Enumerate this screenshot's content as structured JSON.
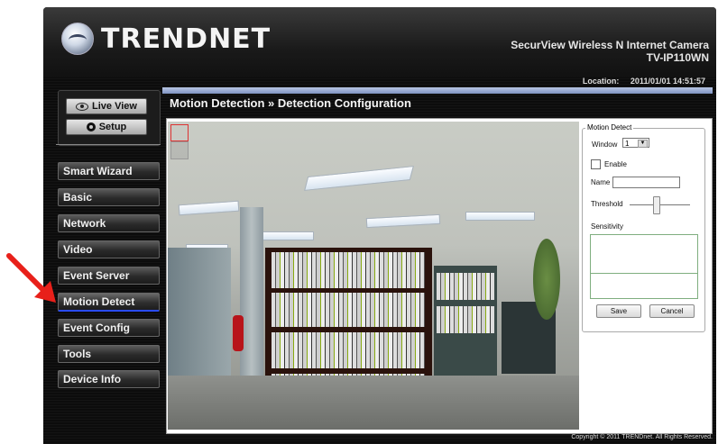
{
  "brand": {
    "logo_text": "TRENDNET"
  },
  "header": {
    "product_line1": "SecurView Wireless N Internet Camera",
    "product_line2": "TV-IP110WN",
    "location_label": "Location:",
    "timestamp": "2011/01/01 14:51:57"
  },
  "top_buttons": {
    "live_view": "Live View",
    "setup": "Setup"
  },
  "nav": {
    "items": [
      "Smart Wizard",
      "Basic",
      "Network",
      "Video",
      "Event Server",
      "Motion Detect",
      "Event Config",
      "Tools",
      "Device Info"
    ],
    "active": "Motion Detect"
  },
  "page": {
    "title": "Motion Detection » Detection Configuration"
  },
  "motion_panel": {
    "legend": "Motion Detect",
    "window_label": "Window",
    "window_value": "1",
    "enable_label": "Enable",
    "name_label": "Name",
    "name_value": "",
    "threshold_label": "Threshold",
    "threshold_level": 0.45,
    "sensitivity_label": "Sensitivity",
    "save_label": "Save",
    "cancel_label": "Cancel"
  },
  "footer": {
    "copyright": "Copyright © 2011 TRENDnet. All Rights Reserved."
  },
  "colors": {
    "active_underline": "#2a4cff",
    "accent_bar": "#8fa1cc",
    "annotation_arrow": "#e8201a"
  }
}
